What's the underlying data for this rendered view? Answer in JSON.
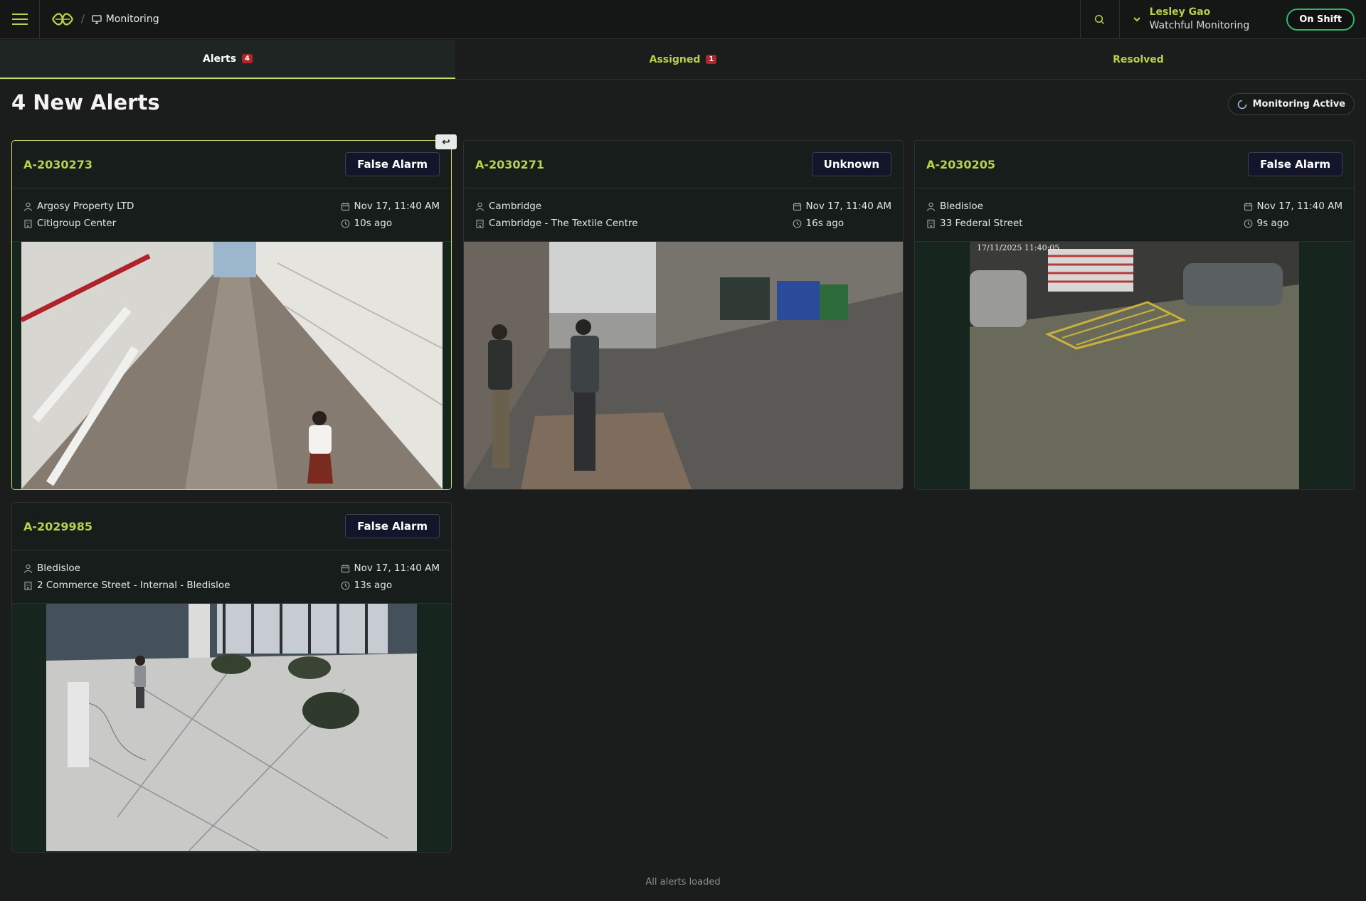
{
  "topbar": {
    "menu_icon": "hamburger-menu-icon",
    "logo_icon": "brand-logo-icon",
    "breadcrumb_sep": "/",
    "breadcrumb_label": "Monitoring",
    "breadcrumb_icon": "monitor-icon",
    "search_icon": "search-icon",
    "user_name": "Lesley Gao",
    "user_org": "Watchful Monitoring",
    "shift_label": "On Shift"
  },
  "tabs": [
    {
      "label": "Alerts",
      "badge": "4",
      "active": true
    },
    {
      "label": "Assigned",
      "badge": "1",
      "active": false
    },
    {
      "label": "Resolved",
      "badge": "",
      "active": false
    }
  ],
  "page": {
    "title": "4 New Alerts",
    "status_label": "Monitoring Active",
    "footer": "All alerts loaded",
    "collapse_glyph": "↩"
  },
  "alerts": [
    {
      "id": "A-2030273",
      "classification": "False Alarm",
      "client": "Argosy Property LTD",
      "site": "Citigroup Center",
      "datetime": "Nov 17, 11:40 AM",
      "age": "10s ago",
      "camera_timestamp": ""
    },
    {
      "id": "A-2030271",
      "classification": "Unknown",
      "client": "Cambridge",
      "site": "Cambridge - The Textile Centre",
      "datetime": "Nov 17, 11:40 AM",
      "age": "16s ago",
      "camera_timestamp": ""
    },
    {
      "id": "A-2030205",
      "classification": "False Alarm",
      "client": "Bledisloe",
      "site": "33 Federal Street",
      "datetime": "Nov 17, 11:40 AM",
      "age": "9s ago",
      "camera_timestamp": "17/11/2025 11:40:05"
    },
    {
      "id": "A-2029985",
      "classification": "False Alarm",
      "client": "Bledisloe",
      "site": "2 Commerce Street - Internal - Bledisloe",
      "datetime": "Nov 17, 11:40 AM",
      "age": "13s ago",
      "camera_timestamp": ""
    }
  ],
  "colors": {
    "accent": "#b7d24a",
    "background": "#1b1c1c",
    "card": "#171d1b",
    "selected_border": "#c9dd6d",
    "badge": "#b3252c",
    "shift_border": "#2fb86a"
  }
}
